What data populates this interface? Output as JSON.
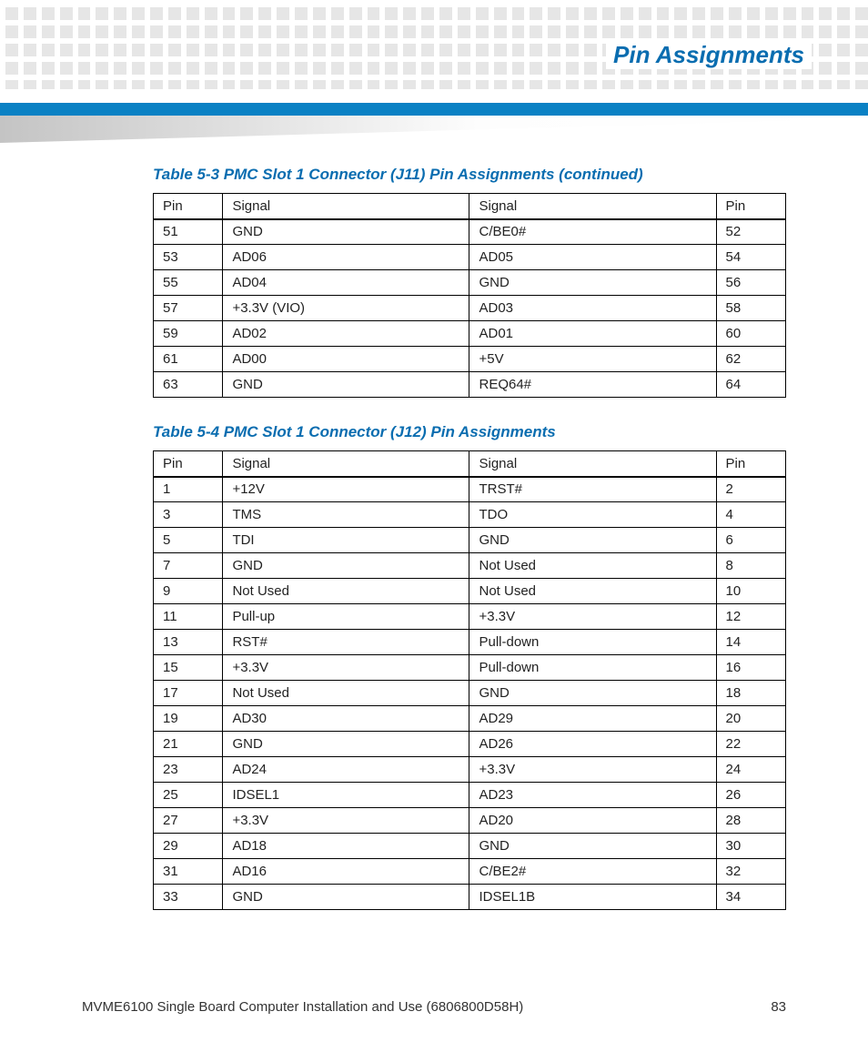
{
  "header": {
    "section_title": "Pin Assignments"
  },
  "table1": {
    "caption": "Table 5-3 PMC Slot 1 Connector (J11) Pin Assignments (continued)",
    "headers": [
      "Pin",
      "Signal",
      "Signal",
      "Pin"
    ],
    "rows": [
      [
        "51",
        "GND",
        "C/BE0#",
        "52"
      ],
      [
        "53",
        "AD06",
        "AD05",
        "54"
      ],
      [
        "55",
        "AD04",
        "GND",
        "56"
      ],
      [
        "57",
        "+3.3V (VIO)",
        "AD03",
        "58"
      ],
      [
        "59",
        "AD02",
        "AD01",
        "60"
      ],
      [
        "61",
        "AD00",
        "+5V",
        "62"
      ],
      [
        "63",
        "GND",
        "REQ64#",
        "64"
      ]
    ]
  },
  "table2": {
    "caption": "Table 5-4 PMC Slot 1 Connector (J12) Pin Assignments",
    "headers": [
      "Pin",
      "Signal",
      "Signal",
      "Pin"
    ],
    "rows": [
      [
        "1",
        "+12V",
        "TRST#",
        "2"
      ],
      [
        "3",
        "TMS",
        "TDO",
        "4"
      ],
      [
        "5",
        "TDI",
        "GND",
        "6"
      ],
      [
        "7",
        "GND",
        "Not Used",
        "8"
      ],
      [
        "9",
        "Not Used",
        "Not Used",
        "10"
      ],
      [
        "11",
        "Pull-up",
        "+3.3V",
        "12"
      ],
      [
        "13",
        "RST#",
        "Pull-down",
        "14"
      ],
      [
        "15",
        "+3.3V",
        "Pull-down",
        "16"
      ],
      [
        "17",
        "Not Used",
        "GND",
        "18"
      ],
      [
        "19",
        "AD30",
        "AD29",
        "20"
      ],
      [
        "21",
        "GND",
        "AD26",
        "22"
      ],
      [
        "23",
        "AD24",
        "+3.3V",
        "24"
      ],
      [
        "25",
        "IDSEL1",
        "AD23",
        "26"
      ],
      [
        "27",
        "+3.3V",
        "AD20",
        "28"
      ],
      [
        "29",
        "AD18",
        "GND",
        "30"
      ],
      [
        "31",
        "AD16",
        "C/BE2#",
        "32"
      ],
      [
        "33",
        "GND",
        "IDSEL1B",
        "34"
      ]
    ]
  },
  "footer": {
    "doc": "MVME6100 Single Board Computer Installation and Use (6806800D58H)",
    "page": "83"
  }
}
